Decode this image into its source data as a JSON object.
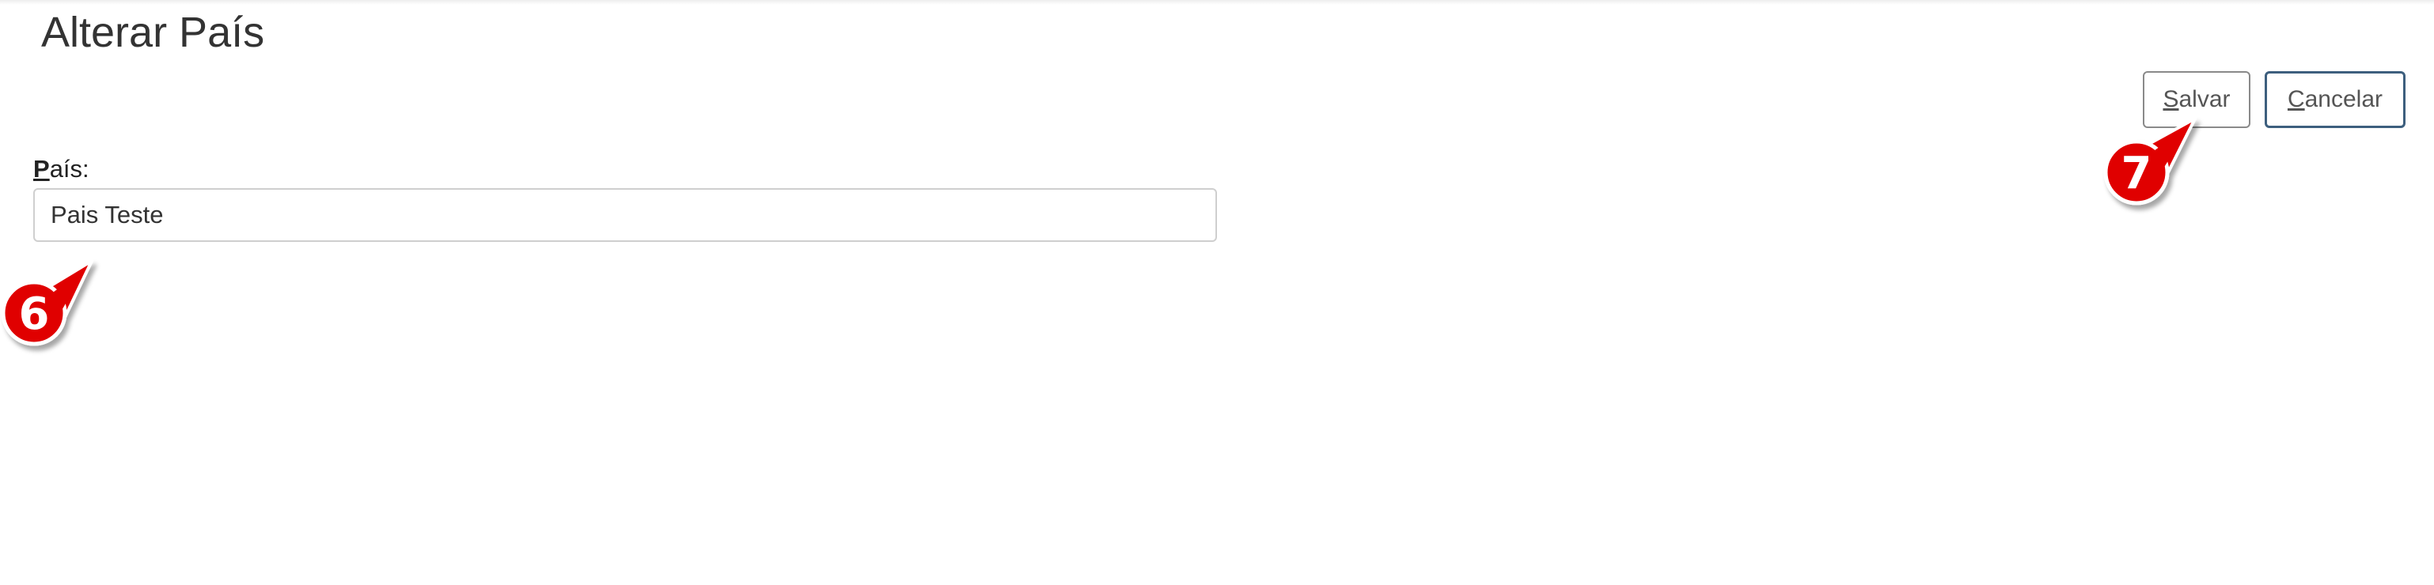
{
  "page": {
    "title": "Alterar País"
  },
  "form": {
    "country_label_mnemonic": "P",
    "country_label_rest": "aís",
    "country_label_colon": ":",
    "country_value": "Pais Teste"
  },
  "actions": {
    "save_mnemonic": "S",
    "save_rest": "alvar",
    "cancel_mnemonic": "C",
    "cancel_rest": "ancelar"
  },
  "annotations": {
    "field_marker": "6",
    "save_marker": "7"
  },
  "colors": {
    "callout": "#e00000",
    "cancel_border": "#3d5f7e"
  }
}
